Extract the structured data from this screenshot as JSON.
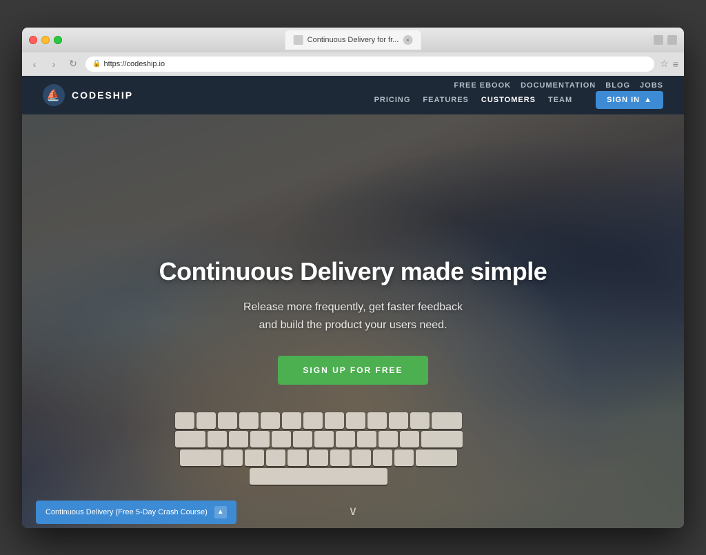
{
  "browser": {
    "tab_title": "Continuous Delivery for fr...",
    "tab_close_icon": "×",
    "url": "https://codeship.io",
    "ssl_label": "🔒",
    "nav_back": "‹",
    "nav_forward": "›",
    "nav_refresh": "↻",
    "star_icon": "☆",
    "menu_icon": "≡"
  },
  "site": {
    "logo_text": "CODESHIP",
    "logo_icon": "⛵"
  },
  "nav": {
    "top_links": [
      "FREE EBOOK",
      "DOCUMENTATION",
      "BLOG",
      "JOBS"
    ],
    "main_links": [
      "PRICING",
      "FEATURES",
      "CUSTOMERS",
      "TEAM"
    ],
    "signin_label": "SIGN IN",
    "signin_icon": "▲"
  },
  "hero": {
    "title": "Continuous Delivery made simple",
    "subtitle_line1": "Release more frequently, get faster feedback",
    "subtitle_line2": "and build the product your users need.",
    "cta_label": "SIGN UP FOR FREE"
  },
  "bottom": {
    "pill_label": "Continuous Delivery (Free 5-Day Crash Course)",
    "pill_arrow": "▲"
  },
  "scroll": {
    "indicator": "∨"
  }
}
